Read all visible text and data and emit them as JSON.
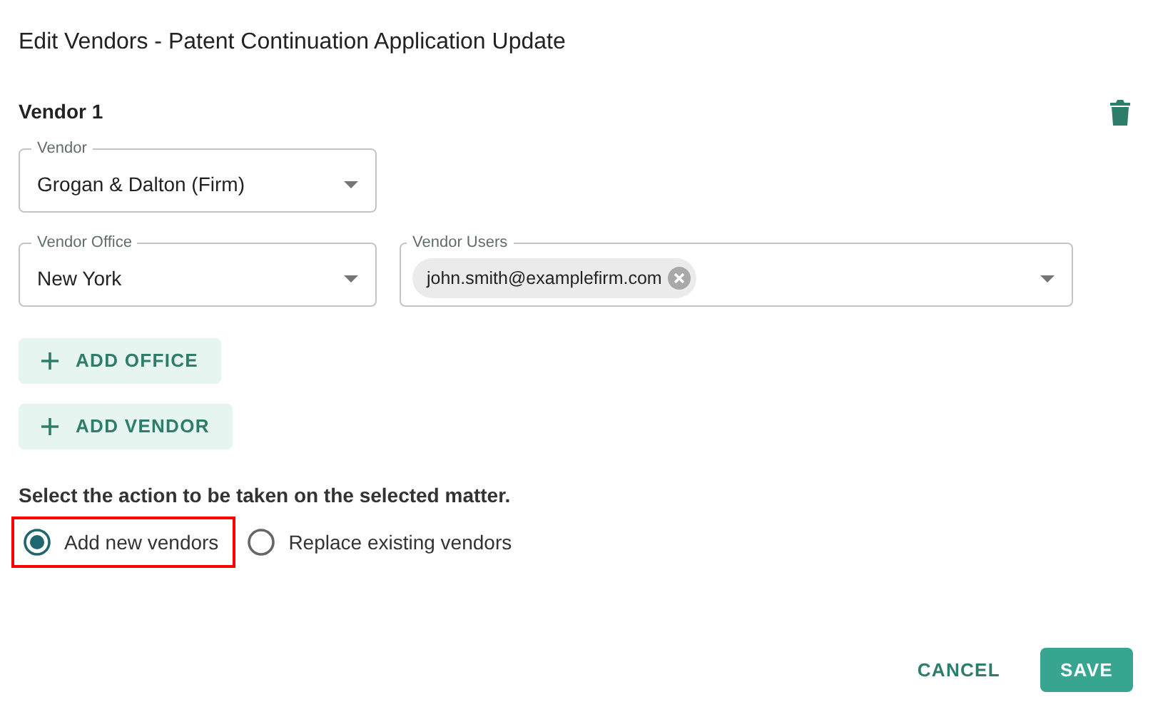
{
  "dialog": {
    "title": "Edit Vendors - Patent Continuation Application Update"
  },
  "vendors": [
    {
      "heading": "Vendor 1",
      "vendor_field": {
        "label": "Vendor",
        "value": "Grogan & Dalton (Firm)"
      },
      "office_field": {
        "label": "Vendor Office",
        "value": "New York"
      },
      "users_field": {
        "label": "Vendor Users",
        "chips": [
          "john.smith@examplefirm.com"
        ]
      },
      "add_office": "ADD OFFICE"
    }
  ],
  "add_vendor": "ADD VENDOR",
  "action_prompt": "Select the action to be taken on the selected matter.",
  "actions": [
    {
      "label": "Add new vendors",
      "selected": true,
      "highlighted": true
    },
    {
      "label": "Replace existing vendors",
      "selected": false,
      "highlighted": false
    }
  ],
  "buttons": [
    {
      "label": "CANCEL",
      "kind": "text"
    },
    {
      "label": "SAVE",
      "kind": "primary"
    }
  ]
}
